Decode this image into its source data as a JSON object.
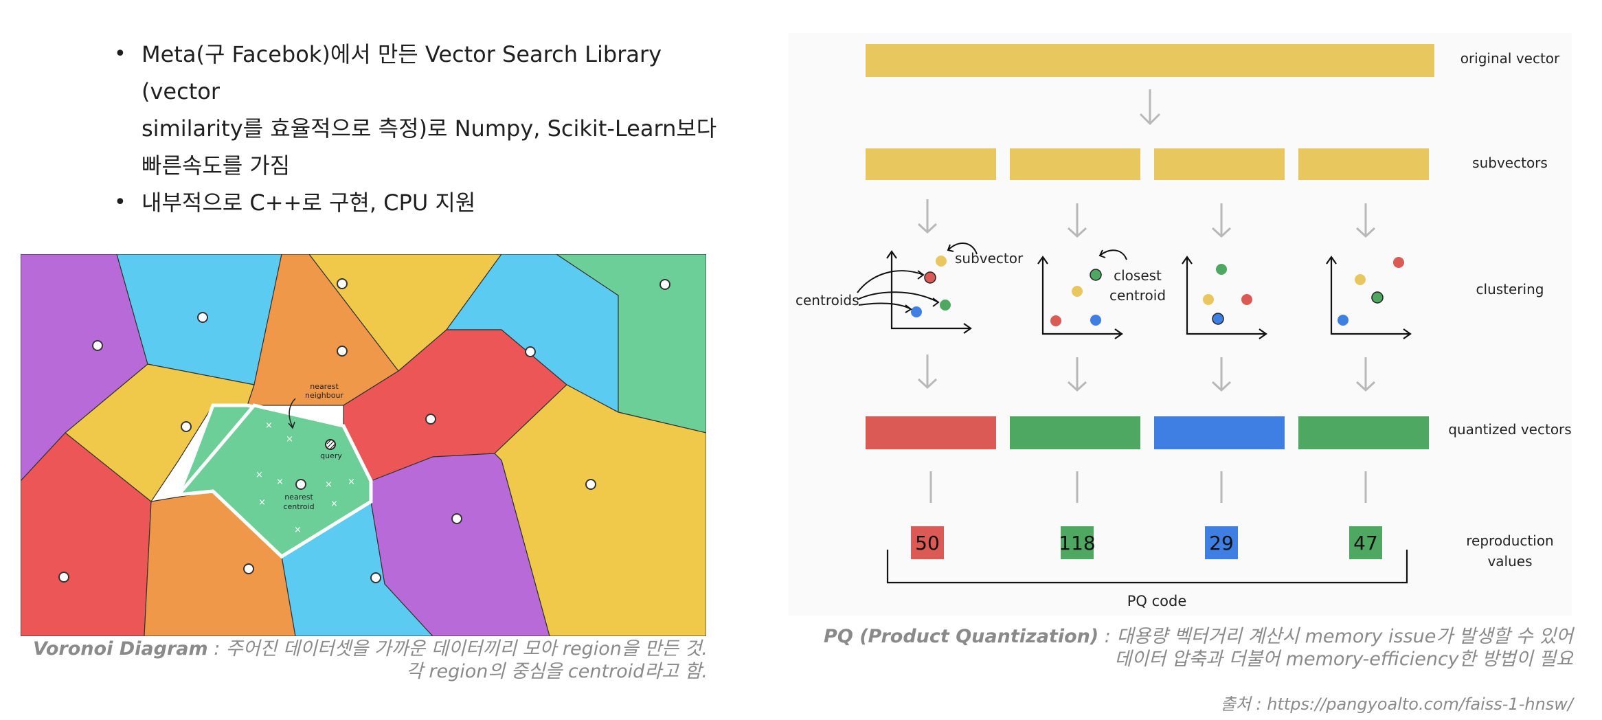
{
  "bullets": [
    {
      "lines": [
        "Meta(구 Facebok)에서 만든 Vector Search Library (vector",
        "similarity를 효율적으로 측정)로 Numpy, Scikit-Learn보다",
        "빠른속도를 가짐"
      ]
    },
    {
      "lines": [
        "내부적으로 C++로 구현, CPU 지원"
      ]
    }
  ],
  "voronoi": {
    "label_nearest_neighbour_1": "nearest",
    "label_nearest_neighbour_2": "neighbour",
    "label_query": "query",
    "label_nearest_centroid_1": "nearest",
    "label_nearest_centroid_2": "centroid",
    "region_colors": [
      "#b86ad9",
      "#5ccbf2",
      "#f0984a",
      "#f0c84a",
      "#ec5656",
      "#6ccf98"
    ]
  },
  "pq": {
    "row_labels": {
      "original": "original vector",
      "subvectors": "subvectors",
      "clustering": "clustering",
      "quantized": "quantized vectors",
      "reproduction_1": "reproduction",
      "reproduction_2": "values"
    },
    "annotations": {
      "subvector": "subvector",
      "centroids": "centroids",
      "closest_1": "closest",
      "closest_2": "centroid"
    },
    "codes": [
      "50",
      "118",
      "29",
      "47"
    ],
    "code_colors": [
      "#db5a56",
      "#4fa861",
      "#3f7fe3",
      "#4fa861"
    ],
    "pq_code_label": "PQ code",
    "vector_color": "#e9c75f"
  },
  "captions": {
    "voronoi_title": "Voronoi Diagram",
    "voronoi_text_1": " : 주어진 데이터셋을 가까운 데이터끼리 모아 region을 만든 것.",
    "voronoi_text_2": "각 region의 중심을 centroid라고 함.",
    "pq_title": "PQ (Product Quantization)",
    "pq_text_1": " : 대용량 벡터거리 계산시 memory issue가 발생할 수 있어",
    "pq_text_2": "데이터 압축과 더불어 memory-efficiency한 방법이 필요",
    "source": "출처 : https://pangyoalto.com/faiss-1-hnsw/"
  }
}
